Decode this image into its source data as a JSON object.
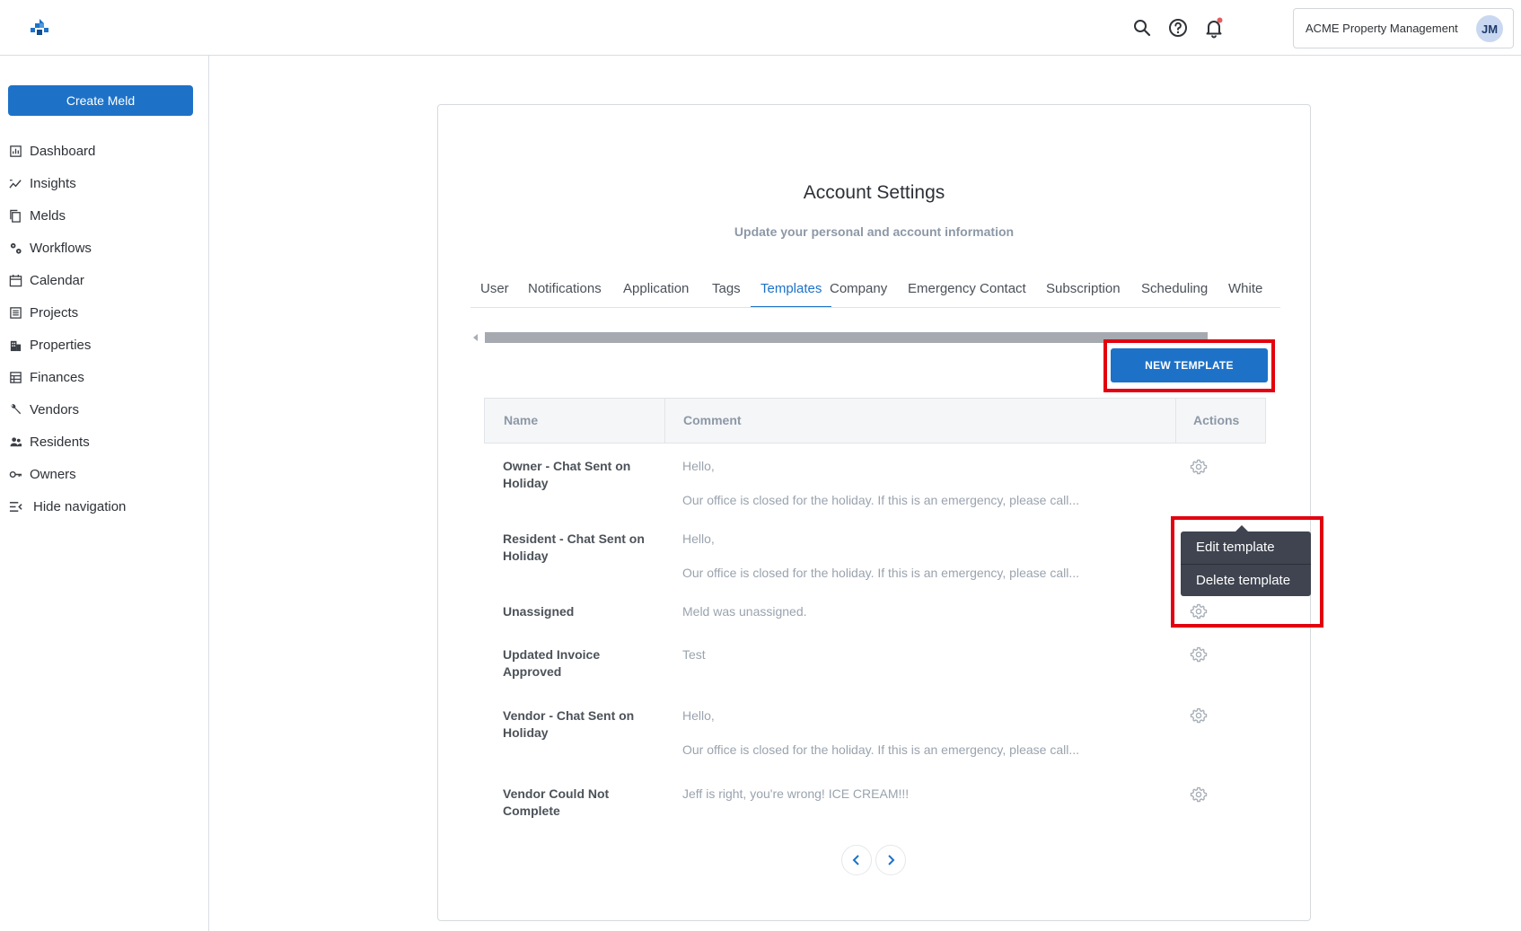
{
  "topbar": {
    "logo_icon": "property-meld-logo",
    "icons": [
      "search-icon",
      "help-icon",
      "bell-icon"
    ],
    "account_name": "ACME Property Management",
    "avatar_initials": "JM",
    "notification_dot_color": "#e35d5d"
  },
  "sidebar": {
    "create_label": "Create Meld",
    "items": [
      {
        "label": "Dashboard",
        "icon": "dashboard-icon"
      },
      {
        "label": "Insights",
        "icon": "insights-icon"
      },
      {
        "label": "Melds",
        "icon": "melds-icon"
      },
      {
        "label": "Workflows",
        "icon": "workflows-icon"
      },
      {
        "label": "Calendar",
        "icon": "calendar-icon"
      },
      {
        "label": "Projects",
        "icon": "projects-icon"
      },
      {
        "label": "Properties",
        "icon": "properties-icon"
      },
      {
        "label": "Finances",
        "icon": "finances-icon"
      },
      {
        "label": "Vendors",
        "icon": "vendors-icon"
      },
      {
        "label": "Residents",
        "icon": "residents-icon"
      },
      {
        "label": "Owners",
        "icon": "owners-icon"
      }
    ],
    "hide_label": "Hide navigation"
  },
  "settings": {
    "title": "Account Settings",
    "subtitle": "Update your personal and account information",
    "tabs": [
      "User",
      "Notifications",
      "Application",
      "Tags",
      "Templates",
      "Company",
      "Emergency Contact",
      "Subscription",
      "Scheduling",
      "White"
    ],
    "active_tab": "Templates",
    "new_template_label": "NEW TEMPLATE",
    "table": {
      "headers": {
        "name": "Name",
        "comment": "Comment",
        "actions": "Actions"
      },
      "rows": [
        {
          "name": "Owner - Chat Sent on Holiday",
          "comment_line1": "Hello,",
          "comment_line2": "Our office is closed for the holiday. If this is an emergency, please call..."
        },
        {
          "name": "Resident - Chat Sent on Holiday",
          "comment_line1": "Hello,",
          "comment_line2": "Our office is closed for the holiday. If this is an emergency, please call..."
        },
        {
          "name": "Unassigned",
          "comment_line1": "Meld was unassigned.",
          "comment_line2": ""
        },
        {
          "name": "Updated Invoice Approved",
          "comment_line1": "Test",
          "comment_line2": ""
        },
        {
          "name": "Vendor - Chat Sent on Holiday",
          "comment_line1": "Hello,",
          "comment_line2": "Our office is closed for the holiday. If this is an emergency, please call..."
        },
        {
          "name": "Vendor Could Not Complete",
          "comment_line1": "Jeff is right, you're wrong! ICE CREAM!!!",
          "comment_line2": ""
        }
      ]
    },
    "actions_menu": {
      "edit": "Edit template",
      "delete": "Delete template"
    },
    "pagination": {
      "prev_icon": "chevron-left-icon",
      "next_icon": "chevron-right-icon"
    }
  },
  "colors": {
    "primary": "#1d72c8",
    "highlight": "#e3000f",
    "muted_text": "#9aa3ae",
    "menu_bg": "#3f4450"
  }
}
